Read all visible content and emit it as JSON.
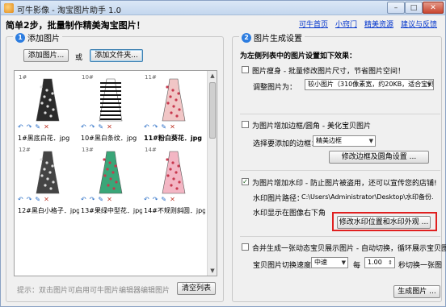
{
  "window": {
    "title": "可牛影像 - 淘宝图片助手 1.0",
    "min_glyph": "–",
    "max_glyph": "□",
    "close_glyph": "✕"
  },
  "header": {
    "text": "简单2步，批量制作精美淘宝图片！",
    "links": [
      "可牛首页",
      "小窍门",
      "精美资源",
      "建议与反馈"
    ]
  },
  "left_panel": {
    "step": "1",
    "title": "添加图片",
    "add_images_button": "添加图片...",
    "or_text": "或",
    "add_folder_button": "添加文件夹...",
    "thumbnails": [
      {
        "index": "1#",
        "name": "1#黑底白花．jpg",
        "pattern": "floral-dark",
        "selected": false
      },
      {
        "index": "10#",
        "name": "10#黑白条纹．jpg",
        "pattern": "stripes",
        "selected": false
      },
      {
        "index": "11#",
        "name": "11#粉白葵花．jpg",
        "pattern": "floral-pink",
        "selected": true
      },
      {
        "index": "12#",
        "name": "12#黑白小格子．jpg",
        "pattern": "plaid",
        "selected": false
      },
      {
        "index": "13#",
        "name": "13#果绿中型花．jpg",
        "pattern": "floral-green",
        "selected": false
      },
      {
        "index": "14#",
        "name": "14#不规则斜圆．jpg",
        "pattern": "dots-pink",
        "selected": false
      }
    ],
    "scroll_up": "▲",
    "scroll_down": "▼",
    "tile_actions": [
      "↶",
      "↷",
      "✎",
      "✕"
    ],
    "hint": "提示：双击图片可启用可牛图片编辑器编辑图片",
    "clear_button": "清空列表"
  },
  "right_panel": {
    "step": "2",
    "title": "图片生成设置",
    "subtitle": "为左侧列表中的图片设置如下效果：",
    "slim": {
      "checked": false,
      "label": "图片瘦身 - 批量修改图片尺寸，节省图片空间！",
      "size_label": "调整图片为：",
      "size_value": "较小图片（310像素宽，约20KB，适合宝贝图片）"
    },
    "border": {
      "checked": false,
      "label": "为图片增加边框/圆角 - 美化宝贝图片",
      "style_label": "选择要添加的边框：",
      "style_value": "精美边框",
      "edit_button": "修改边框及圆角设置 ..."
    },
    "watermark": {
      "checked": true,
      "check_mark": "✓",
      "label": "为图片增加水印 - 防止图片被盗用，还可以宣传您的店铺!",
      "path_label": "水印图片路径：",
      "path_value": "C:\\Users\\Administrator\\Desktop\\水印备份.",
      "position_text": "水印显示在图像右下角",
      "edit_button": "修改水印位置和水印外观 ..."
    },
    "slideshow": {
      "checked": false,
      "label": "合并生成一张动态宝贝展示图片 - 自动切换，循环展示宝贝图片",
      "speed_label": "宝贝图片切换速度：",
      "speed_value": "中速",
      "per_label": "每",
      "seconds_value": "1.00",
      "seconds_suffix": "秒切换一张图"
    },
    "generate_button": "生成图片 ..."
  },
  "colors": {
    "link": "#0033cc",
    "step_badge": "#2d7de0",
    "highlight_box": "#e02020"
  }
}
